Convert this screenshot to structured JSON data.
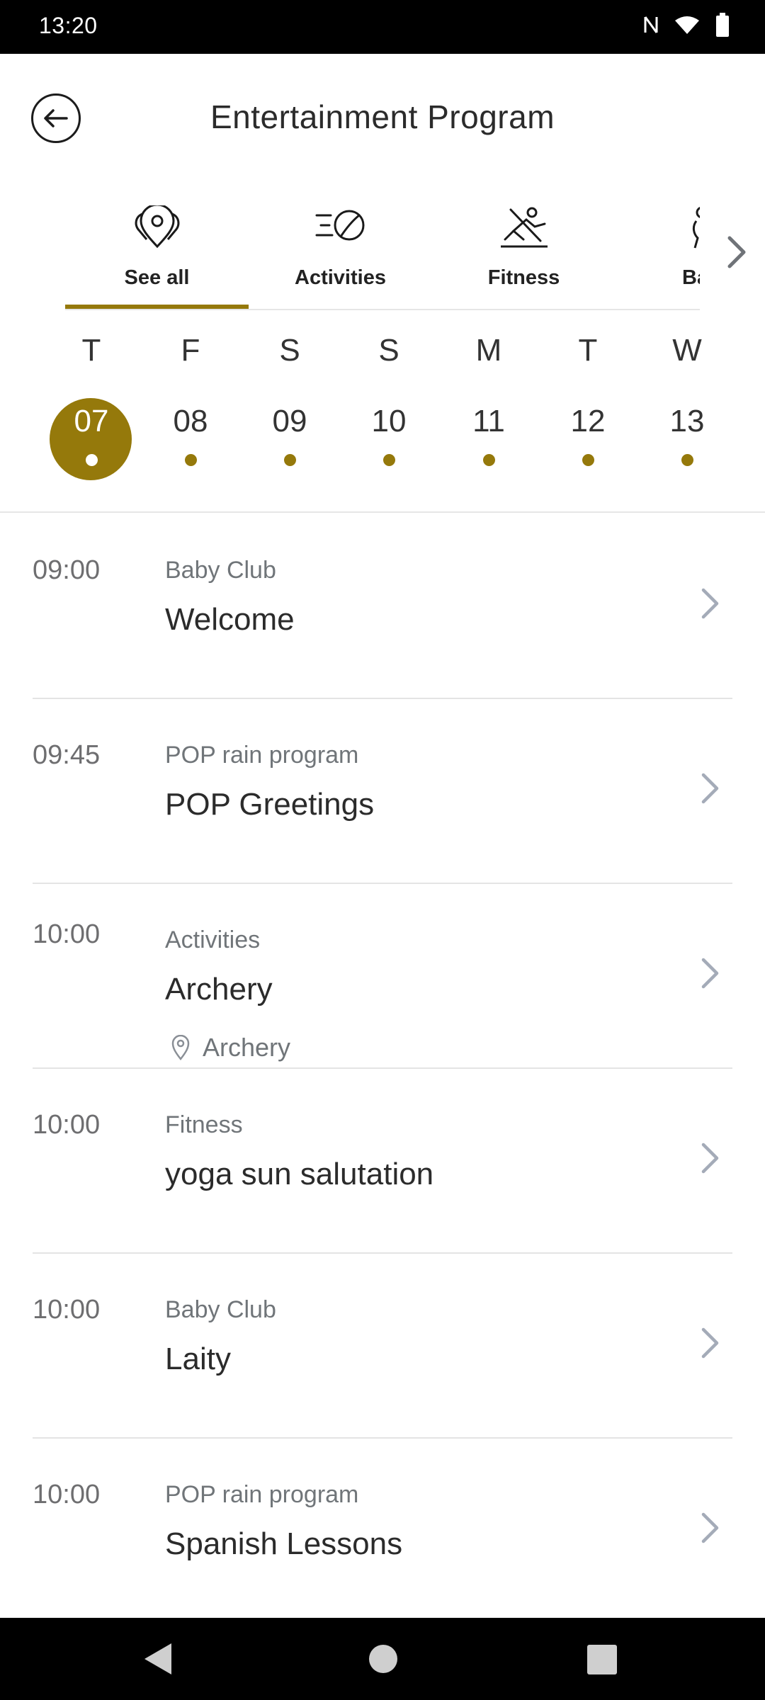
{
  "status_bar": {
    "time": "13:20"
  },
  "header": {
    "title": "Entertainment Program"
  },
  "tabs": [
    {
      "label": "See all",
      "icon": "map-pins-icon",
      "active": true
    },
    {
      "label": "Activities",
      "icon": "ball-speed-icon",
      "active": false
    },
    {
      "label": "Fitness",
      "icon": "fitness-person-icon",
      "active": false
    },
    {
      "label": "Baby",
      "icon": "baby-icon",
      "active": false
    }
  ],
  "days": [
    {
      "letter": "T",
      "num": "07",
      "selected": true
    },
    {
      "letter": "F",
      "num": "08",
      "selected": false
    },
    {
      "letter": "S",
      "num": "09",
      "selected": false
    },
    {
      "letter": "S",
      "num": "10",
      "selected": false
    },
    {
      "letter": "M",
      "num": "11",
      "selected": false
    },
    {
      "letter": "T",
      "num": "12",
      "selected": false
    },
    {
      "letter": "W",
      "num": "13",
      "selected": false
    }
  ],
  "events": [
    {
      "time": "09:00",
      "category": "Baby Club",
      "name": "Welcome"
    },
    {
      "time": "09:45",
      "category": "POP rain program",
      "name": "POP Greetings"
    },
    {
      "time": "10:00",
      "category": "Activities",
      "name": "Archery",
      "location": "Archery"
    },
    {
      "time": "10:00",
      "category": "Fitness",
      "name": "yoga sun salutation"
    },
    {
      "time": "10:00",
      "category": "Baby Club",
      "name": "Laity"
    },
    {
      "time": "10:00",
      "category": "POP rain program",
      "name": "Spanish Lessons"
    }
  ],
  "colors": {
    "accent": "#95790b",
    "text": "#2b2b2b",
    "muted": "#707579",
    "divider": "#e4e4e4"
  }
}
